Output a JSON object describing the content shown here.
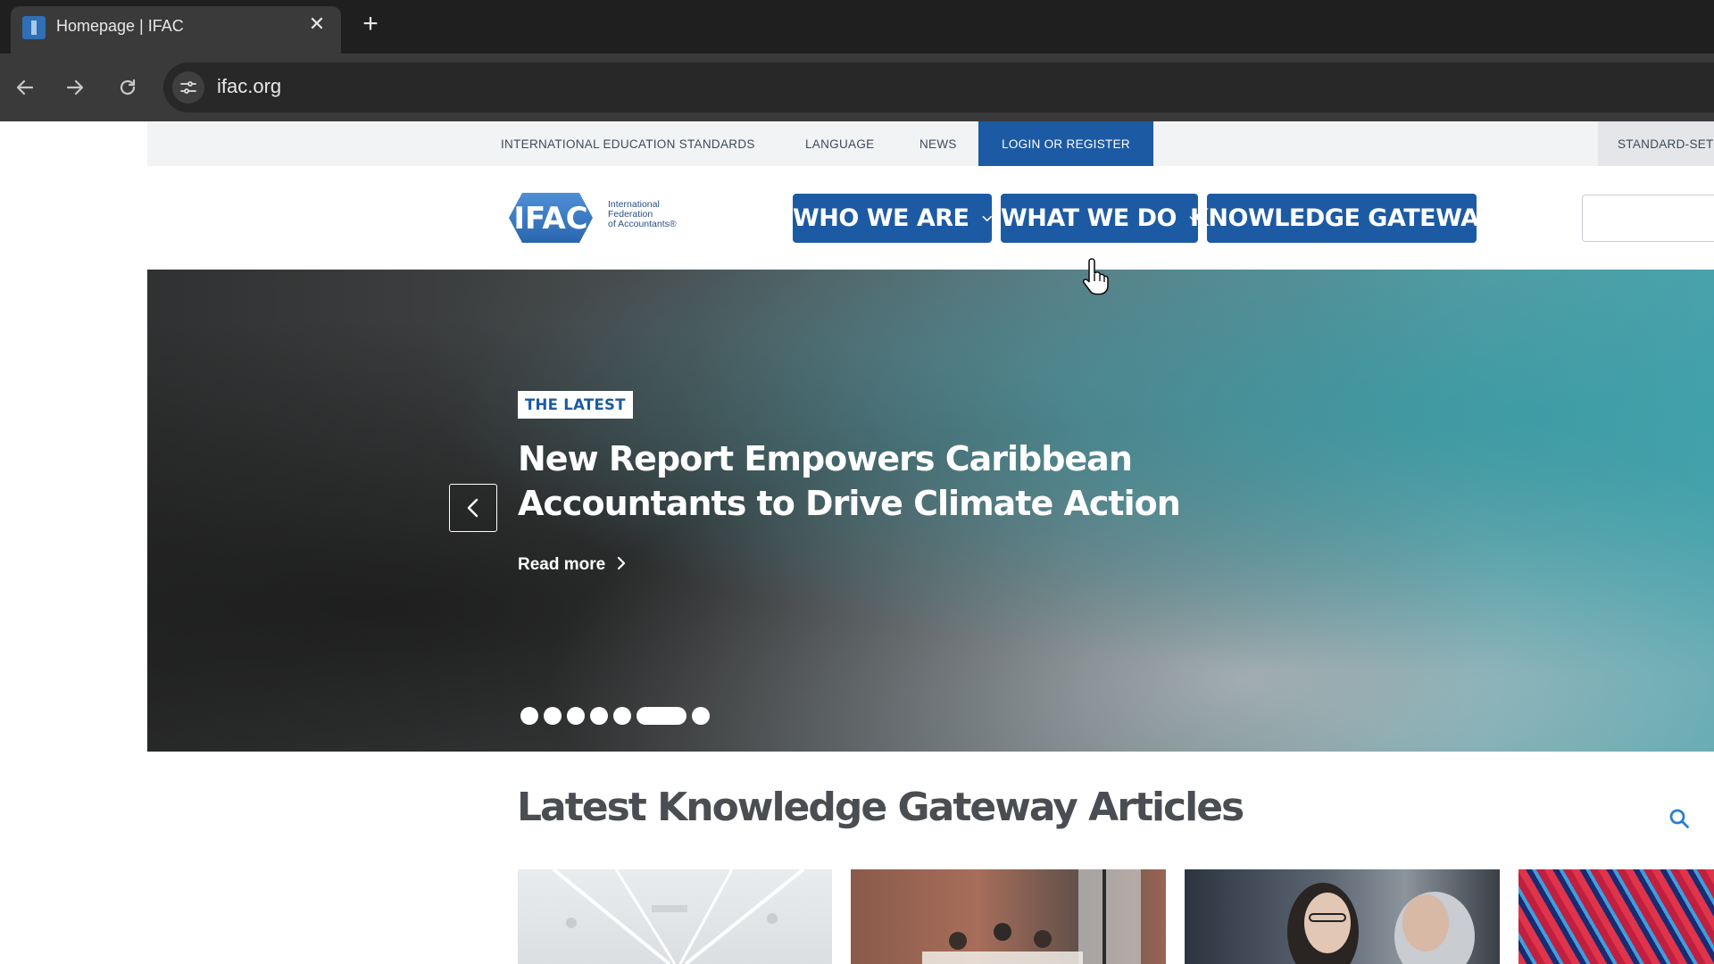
{
  "browser": {
    "tab_title": "Homepage | IFAC",
    "tab_close": "✕",
    "new_tab": "+",
    "url": "ifac.org"
  },
  "utility_nav": {
    "items": [
      "INTERNATIONAL EDUCATION STANDARDS",
      "LANGUAGE",
      "NEWS"
    ],
    "login": "LOGIN OR REGISTER",
    "standard_setting": "STANDARD-SET"
  },
  "logo": {
    "mark": "IFAC",
    "line1": "International",
    "line2": "Federation",
    "line3": "of Accountants®"
  },
  "main_nav": {
    "who_we_are": "WHO WE ARE",
    "what_we_do": "WHAT WE DO",
    "knowledge_gateway": "KNOWLEDGE GATEWAY"
  },
  "hero": {
    "badge": "THE LATEST",
    "title": "New Report Empowers Caribbean Accountants to Drive Climate Action",
    "read_more": "Read more",
    "slide_count": 7,
    "active_slide": 6
  },
  "articles": {
    "title": "Latest Knowledge Gateway Articles"
  },
  "colors": {
    "brand_blue": "#1d5aa4",
    "utility_bg": "#f2f3f5",
    "heading_gray": "#4a4d52"
  }
}
